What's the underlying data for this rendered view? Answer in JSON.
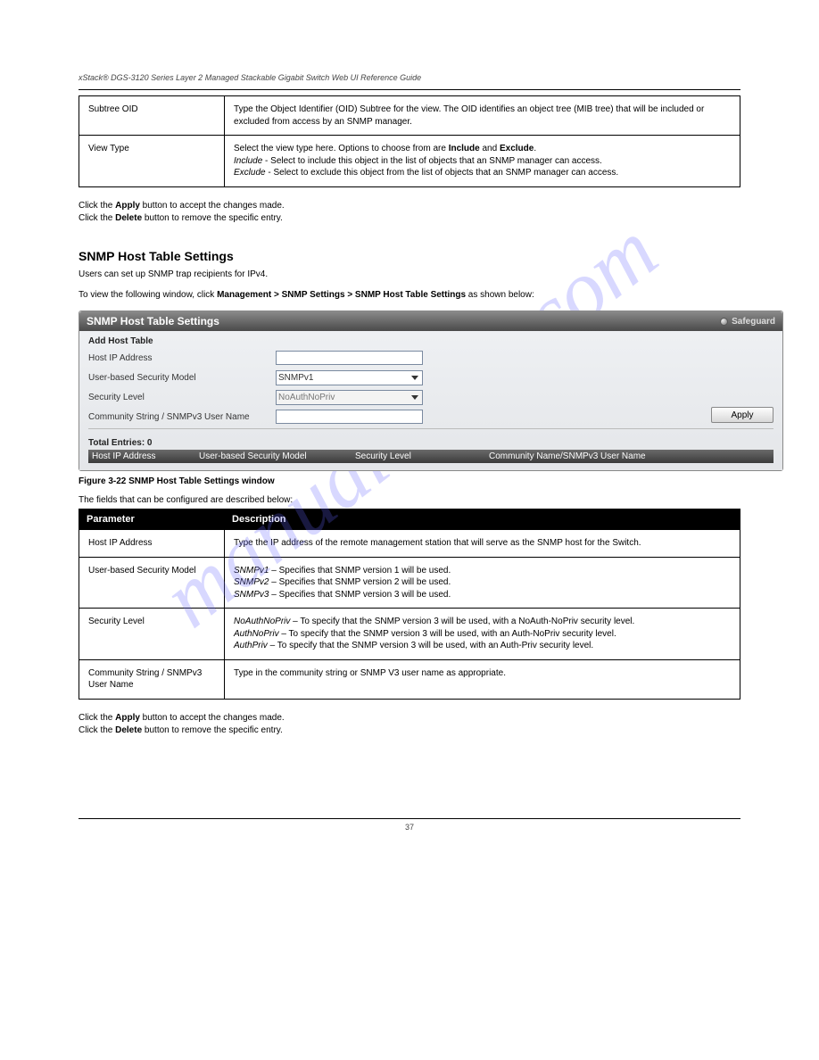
{
  "header": {
    "subtitle": "xStack® DGS-3120 Series Layer 2 Managed Stackable Gigabit Switch Web UI Reference Guide"
  },
  "table1": {
    "rows": [
      {
        "param": "Subtree OID",
        "desc": "Type the Object Identifier (OID) Subtree for the view. The OID identifies an object tree (MIB tree) that will be included or excluded from access by an SNMP manager."
      },
      {
        "param": "View Type",
        "desc_a": "Select the view type here. Options to choose from are ",
        "b1": "Include",
        "mid": " and ",
        "b2": "Exclude",
        "desc_b": ". ",
        "line2a": "Include",
        "line2b": " - Select to include this object in the list of objects that an SNMP manager can access. ",
        "line3a": "Exclude",
        "line3b": " - Select to exclude this object from the list of objects that an SNMP manager can access."
      }
    ]
  },
  "post_table1": {
    "a": "Click the ",
    "b": "Apply",
    "c": " button to accept the changes made. ",
    "d": "Click the ",
    "e": "Delete",
    "f": " button to remove the specific entry."
  },
  "section": {
    "title": "SNMP Host Table Settings",
    "p1": "Users can set up SNMP trap recipients for IPv4.",
    "p2a": "To view the following window, click ",
    "navpath": "Management > SNMP Settings > SNMP Host Table Settings",
    "p2b": " as shown below:"
  },
  "shot": {
    "title": "SNMP Host Table Settings",
    "safeguard": "Safeguard",
    "heading": "Add Host Table",
    "fields": {
      "host_ip_label": "Host IP Address",
      "model_label": "User-based Security Model",
      "model_value": "SNMPv1",
      "level_label": "Security Level",
      "level_value": "NoAuthNoPriv",
      "comm_label": "Community String / SNMPv3 User Name"
    },
    "apply": "Apply",
    "total": "Total Entries: 0",
    "gridheaders": [
      "Host IP Address",
      "User-based Security Model",
      "Security Level",
      "Community Name/SNMPv3 User Name"
    ]
  },
  "caption": "Figure 3-22 SNMP Host Table Settings window",
  "tabledesc": "The fields that can be configured are described below:",
  "table2": {
    "header": [
      "Parameter",
      "Description"
    ],
    "rows": [
      {
        "param": "Host IP Address",
        "desc": "Type the IP address of the remote management station that will serve as the SNMP host for the Switch."
      },
      {
        "param": "User-based Security Model",
        "l1a": "SNMPv1",
        "l1b": " – Specifies that SNMP version 1 will be used.",
        "l2a": "SNMPv2",
        "l2b": " – Specifies that SNMP version 2 will be used.",
        "l3a": "SNMPv3",
        "l3b": " – Specifies that SNMP version 3 will be used."
      },
      {
        "param": "Security Level",
        "l1a": "NoAuthNoPriv",
        "l1b": " – To specify that the SNMP version 3 will be used, with a NoAuth-NoPriv security level.",
        "l2a": "AuthNoPriv",
        "l2b": " – To specify that the SNMP version 3 will be used, with an Auth-NoPriv security level.",
        "l3a": "AuthPriv",
        "l3b": " – To specify that the SNMP version 3 will be used, with an Auth-Priv security level."
      },
      {
        "param": "Community String / SNMPv3 User Name",
        "desc": "Type in the community string or SNMP V3 user name as appropriate."
      }
    ]
  },
  "post_table2": {
    "a": "Click the ",
    "b": "Apply",
    "c": " button to accept the changes made. ",
    "d": "Click the ",
    "e": "Delete",
    "f": " button to remove the specific entry."
  },
  "footer": "37"
}
